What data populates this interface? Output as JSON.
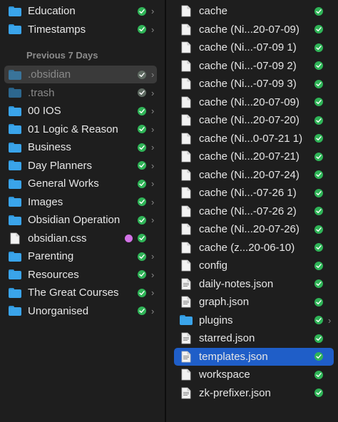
{
  "left_column": {
    "top_items": [
      {
        "label": "Education",
        "kind": "folder",
        "chevron": true
      },
      {
        "label": "Timestamps",
        "kind": "folder",
        "chevron": true
      }
    ],
    "section_header": "Previous 7 Days",
    "items": [
      {
        "label": ".obsidian",
        "kind": "folder",
        "chevron": true,
        "state": "selected-grey",
        "dim": true
      },
      {
        "label": ".trash",
        "kind": "folder",
        "chevron": true,
        "dim": true
      },
      {
        "label": "00 IOS",
        "kind": "folder",
        "chevron": true
      },
      {
        "label": "01 Logic & Reason",
        "kind": "folder",
        "chevron": true
      },
      {
        "label": "Business",
        "kind": "folder",
        "chevron": true
      },
      {
        "label": "Day Planners",
        "kind": "folder",
        "chevron": true
      },
      {
        "label": "General Works",
        "kind": "folder",
        "chevron": true
      },
      {
        "label": "Images",
        "kind": "folder",
        "chevron": true
      },
      {
        "label": "Obsidian Operation",
        "kind": "folder",
        "chevron": true
      },
      {
        "label": "obsidian.css",
        "kind": "doc",
        "chevron": false,
        "tag_color": "#d272e6"
      },
      {
        "label": "Parenting",
        "kind": "folder",
        "chevron": true
      },
      {
        "label": "Resources",
        "kind": "folder",
        "chevron": true
      },
      {
        "label": "The Great Courses",
        "kind": "folder",
        "chevron": true
      },
      {
        "label": "Unorganised",
        "kind": "folder",
        "chevron": true
      }
    ]
  },
  "right_column": {
    "items": [
      {
        "label": "cache",
        "kind": "doc"
      },
      {
        "label": "cache (Ni...20-07-09)",
        "kind": "doc"
      },
      {
        "label": "cache (Ni...-07-09 1)",
        "kind": "doc"
      },
      {
        "label": "cache (Ni...-07-09 2)",
        "kind": "doc"
      },
      {
        "label": "cache (Ni...-07-09 3)",
        "kind": "doc"
      },
      {
        "label": "cache (Ni...20-07-09)",
        "kind": "doc"
      },
      {
        "label": "cache (Ni...20-07-20)",
        "kind": "doc"
      },
      {
        "label": "cache (Ni...0-07-21 1)",
        "kind": "doc"
      },
      {
        "label": "cache (Ni...20-07-21)",
        "kind": "doc"
      },
      {
        "label": "cache (Ni...20-07-24)",
        "kind": "doc"
      },
      {
        "label": "cache (Ni...-07-26 1)",
        "kind": "doc"
      },
      {
        "label": "cache (Ni...-07-26 2)",
        "kind": "doc"
      },
      {
        "label": "cache (Ni...20-07-26)",
        "kind": "doc"
      },
      {
        "label": "cache (z...20-06-10)",
        "kind": "doc"
      },
      {
        "label": "config",
        "kind": "doc"
      },
      {
        "label": "daily-notes.json",
        "kind": "json"
      },
      {
        "label": "graph.json",
        "kind": "json"
      },
      {
        "label": "plugins",
        "kind": "folder",
        "chevron": true
      },
      {
        "label": "starred.json",
        "kind": "json"
      },
      {
        "label": "templates.json",
        "kind": "json",
        "state": "selected-blue"
      },
      {
        "label": "workspace",
        "kind": "doc"
      },
      {
        "label": "zk-prefixer.json",
        "kind": "json"
      }
    ]
  },
  "icons": {
    "folder": "folder-icon",
    "doc": "document-icon",
    "json": "json-file-icon",
    "sync": "icloud-synced-check-icon",
    "chevron": "chevron-right-icon"
  },
  "colors": {
    "background": "#1e1e1e",
    "selection_blue": "#1f5ec8",
    "selection_grey": "#3a3a3a",
    "folder": "#3aa4ea",
    "synced_green": "#2fb457",
    "tag_purple": "#d272e6"
  },
  "chevron_glyph": "›"
}
